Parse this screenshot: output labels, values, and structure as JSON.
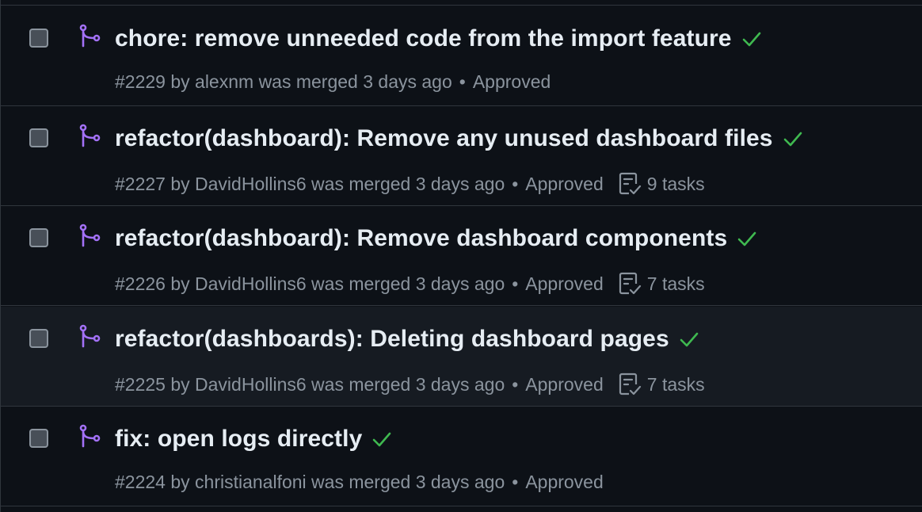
{
  "colors": {
    "background": "#0d1117",
    "hover_row": "#161b22",
    "border": "#30363d",
    "title": "#e6edf3",
    "meta": "#8b949e",
    "merged_icon": "#a371f7",
    "check": "#3fb950"
  },
  "icons": {
    "merged": "git-merge-icon",
    "status": "check-icon",
    "tasks": "tasklist-icon"
  },
  "pull_requests": [
    {
      "title": "chore: remove unneeded code from the import feature",
      "meta": "#2229 by alexnm was merged 3 days ago",
      "separator": "•",
      "review": "Approved",
      "tasks": null
    },
    {
      "title": "refactor(dashboard): Remove any unused dashboard files",
      "meta": "#2227 by DavidHollins6 was merged 3 days ago",
      "separator": "•",
      "review": "Approved",
      "tasks": "9 tasks"
    },
    {
      "title": "refactor(dashboard): Remove dashboard components",
      "meta": "#2226 by DavidHollins6 was merged 3 days ago",
      "separator": "•",
      "review": "Approved",
      "tasks": "7 tasks"
    },
    {
      "title": "refactor(dashboards): Deleting dashboard pages",
      "meta": "#2225 by DavidHollins6 was merged 3 days ago",
      "separator": "•",
      "review": "Approved",
      "tasks": "7 tasks"
    },
    {
      "title": "fix: open logs directly",
      "meta": "#2224 by christianalfoni was merged 3 days ago",
      "separator": "•",
      "review": "Approved",
      "tasks": null
    }
  ]
}
